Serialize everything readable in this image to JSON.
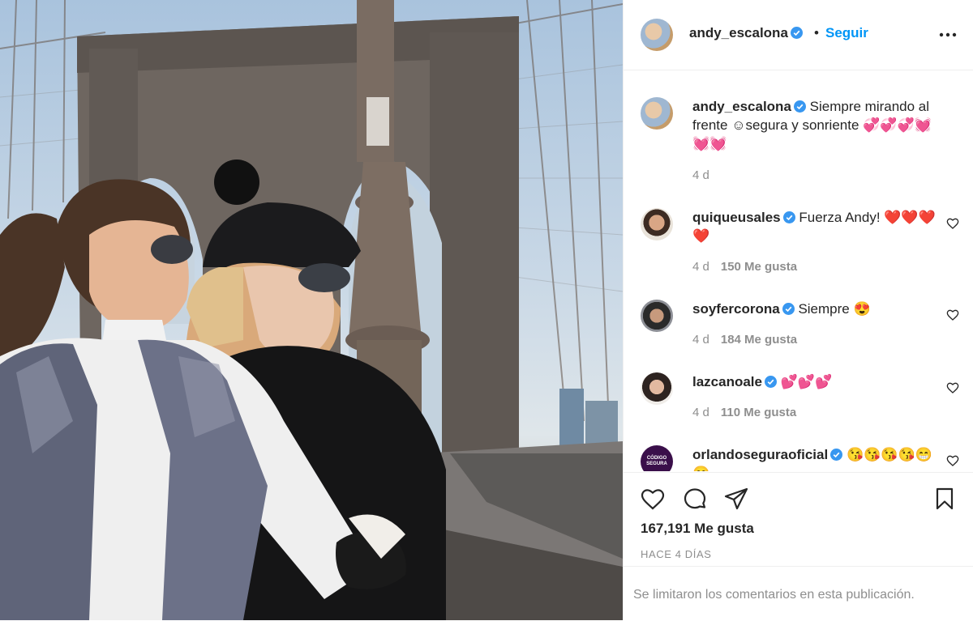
{
  "header": {
    "username": "andy_escalona",
    "separator": "•",
    "follow_label": "Seguir"
  },
  "caption": {
    "username": "andy_escalona",
    "text": "Siempre mirando al frente ☺segura y sonriente 💞💞💞💓💓💓",
    "time": "4 d"
  },
  "comments": [
    {
      "username": "quiqueusales",
      "text": "Fuerza Andy! ❤️❤️❤️❤️",
      "time": "4 d",
      "likes": "150 Me gusta"
    },
    {
      "username": "soyfercorona",
      "text": "Siempre 😍",
      "time": "4 d",
      "likes": "184 Me gusta"
    },
    {
      "username": "lazcanoale",
      "text": "💕💕💕",
      "time": "4 d",
      "likes": "110 Me gusta"
    },
    {
      "username": "orlandoseguraoficial",
      "text": "😘😘😘😘😁😁",
      "avatar_text": "CÓDIGO SEGURA"
    }
  ],
  "actions": {
    "likes_count": "167,191 Me gusta",
    "posted_ago": "HACE 4 DÍAS"
  },
  "footer": {
    "limited_text": "Se limitaron los comentarios en esta publicación."
  },
  "colors": {
    "link_blue": "#0095f6",
    "verified_blue": "#3897f0",
    "text_primary": "#262626",
    "text_secondary": "#8e8e8e"
  }
}
